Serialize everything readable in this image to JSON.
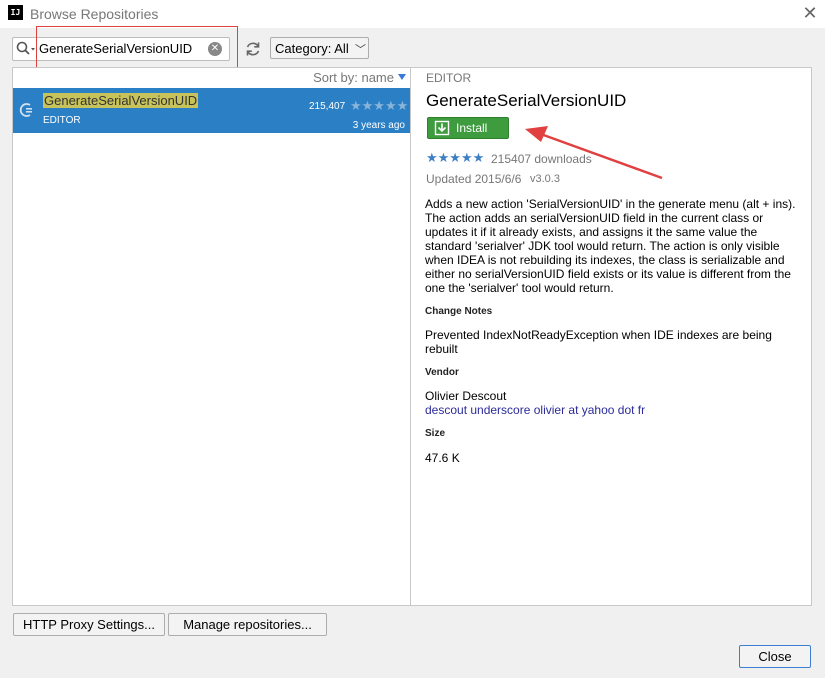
{
  "window": {
    "title": "Browse Repositories",
    "logo_text": "IJ"
  },
  "search": {
    "value": "GenerateSerialVersionUID",
    "placeholder": ""
  },
  "category": {
    "label": "Category: All"
  },
  "list": {
    "sort_label": "Sort by: name",
    "items": [
      {
        "name": "GenerateSerialVersionUID",
        "category": "EDITOR",
        "downloads": "215,407",
        "age": "3 years ago",
        "rating_stars": 5
      }
    ]
  },
  "detail": {
    "category": "EDITOR",
    "title": "GenerateSerialVersionUID",
    "install_label": "Install",
    "rating_stars": 5,
    "downloads": "215407 downloads",
    "updated": "Updated 2015/6/6",
    "version": "v3.0.3",
    "description": "Adds a new action 'SerialVersionUID' in the generate menu (alt + ins). The action adds an serialVersionUID field in the current class or updates it if it already exists, and assigns it the same value the standard 'serialver' JDK tool would return. The action is only visible when IDEA is not rebuilding its indexes, the class is serializable and either no serialVersionUID field exists or its value is different from the one the 'serialver' tool would return.",
    "change_notes_header": "Change Notes",
    "change_notes": "Prevented IndexNotReadyException when IDE indexes are being rebuilt",
    "vendor_header": "Vendor",
    "vendor_name": "Olivier Descout",
    "vendor_email": "descout underscore olivier at yahoo dot fr",
    "size_header": "Size",
    "size": "47.6 K"
  },
  "buttons": {
    "proxy": "HTTP Proxy Settings...",
    "manage": "Manage repositories...",
    "close": "Close"
  },
  "colors": {
    "selection": "#2a7fc5",
    "install": "#3e9b3e",
    "highlight": "#c7c25a",
    "annotation": "#e04040"
  },
  "icons": [
    "search-icon",
    "clear-search-icon",
    "refresh-icon",
    "plugin-icon",
    "install-download-icon",
    "close-window-icon"
  ]
}
